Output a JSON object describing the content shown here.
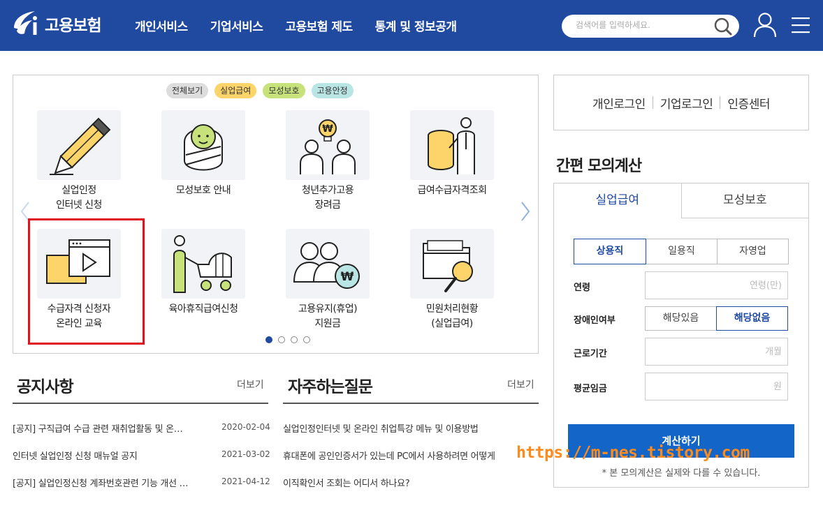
{
  "header": {
    "logo_text": "고용보험",
    "nav": [
      "개인서비스",
      "기업서비스",
      "고용보험 제도",
      "통계 및 정보공개"
    ],
    "search_placeholder": "검색어를 입력하세요."
  },
  "services": {
    "chips": [
      "전체보기",
      "실업급여",
      "모성보호",
      "고용안정"
    ],
    "tiles": [
      {
        "line1": "실업인정",
        "line2": "인터넷 신청",
        "icon": "pencil-icon"
      },
      {
        "line1": "모성보호 안내",
        "line2": "",
        "icon": "baby-icon"
      },
      {
        "line1": "청년추가고용",
        "line2": "장려금",
        "icon": "youth-employment-icon"
      },
      {
        "line1": "급여수급자격조회",
        "line2": "",
        "icon": "coin-stack-icon"
      },
      {
        "line1": "수급자격 신청자",
        "line2": "온라인 교육",
        "icon": "video-play-icon"
      },
      {
        "line1": "육아휴직급여신청",
        "line2": "",
        "icon": "stroller-icon"
      },
      {
        "line1": "고용유지(휴업)",
        "line2": "지원금",
        "icon": "people-won-icon"
      },
      {
        "line1": "민원처리현황",
        "line2": "(실업급여)",
        "icon": "folder-search-icon"
      }
    ],
    "page_dots": 4,
    "active_dot": 1
  },
  "notice": {
    "title": "공지사항",
    "more": "더보기",
    "items": [
      {
        "text": "[공지] 구직급여 수급 관련 재취업활동 및 온…",
        "date": "2020-02-04"
      },
      {
        "text": "인터넷 실업인정 신청 매뉴얼 공지",
        "date": "2021-03-02"
      },
      {
        "text": "[공지] 실업인정신청 계좌번호관련 기능 개선 …",
        "date": "2021-04-12"
      }
    ]
  },
  "faq": {
    "title": "자주하는질문",
    "more": "더보기",
    "items": [
      "실업인정인터넷 및 온라인 취업특강 메뉴 및 이용방법",
      "휴대폰에 공인인증서가 있는데 PC에서 사용하려면 어떻게",
      "이직확인서 조회는 어디서 하나요?"
    ]
  },
  "login": {
    "links": [
      "개인로그인",
      "기업로그인",
      "인증센터"
    ]
  },
  "calculator": {
    "title": "간편 모의계산",
    "tabs": [
      "실업급여",
      "모성보호"
    ],
    "job_types": [
      "상용직",
      "일용직",
      "자영업"
    ],
    "selected_job_type": "상용직",
    "age_label": "연령",
    "age_placeholder": "연령(만)",
    "disability_label": "장애인여부",
    "disability_options": [
      "해당있음",
      "해당없음"
    ],
    "selected_disability": "해당없음",
    "period_label": "근로기간",
    "period_placeholder": "개월",
    "wage_label": "평균임금",
    "wage_placeholder": "원",
    "button": "계산하기",
    "note": "* 본 모의계산은 실제와 다를 수 있습니다."
  },
  "watermark": "https://m-nes.tistory.com",
  "colors": {
    "header_bg": "#1f4aa0",
    "accent": "#1366c7",
    "highlight_border": "#e0121b",
    "watermark": "#ff8a1c"
  }
}
